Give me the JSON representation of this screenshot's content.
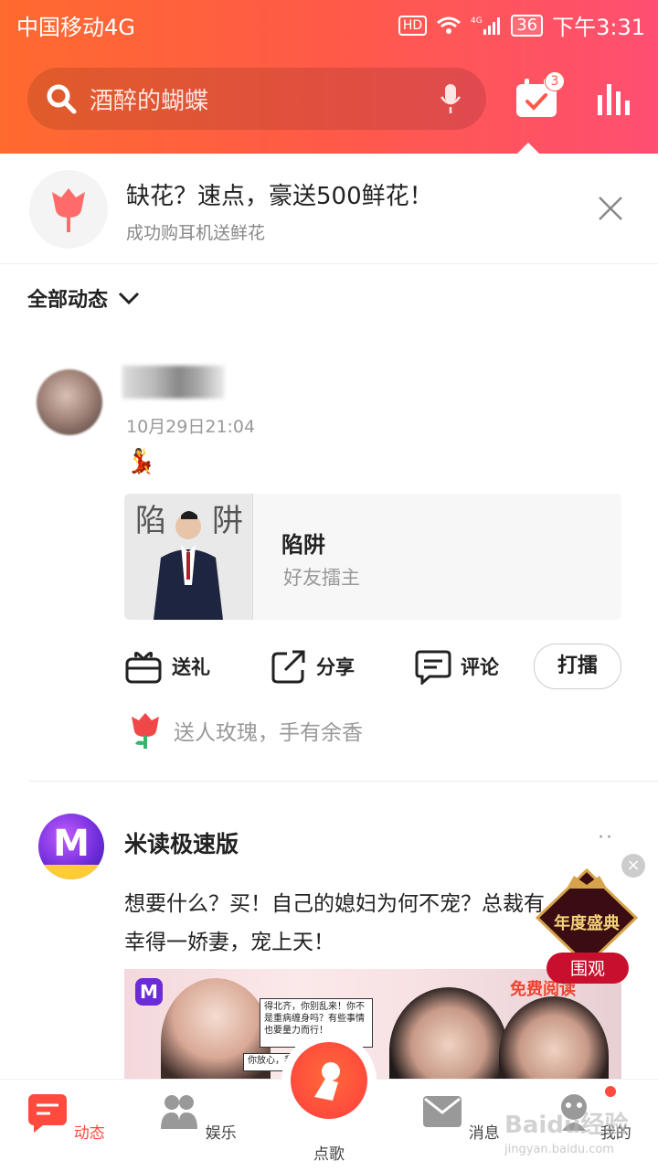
{
  "status_bar": {
    "carrier": "中国移动4G",
    "hd": "HD",
    "network": "4G",
    "battery": "36",
    "time": "下午3:31"
  },
  "header": {
    "search_placeholder": "酒醉的蝴蝶",
    "calendar_badge": "3"
  },
  "promo": {
    "title": "缺花？速点，豪送500鲜花！",
    "subtitle": "成功购耳机送鲜花"
  },
  "filter": {
    "label": "全部动态"
  },
  "post1": {
    "time": "10月29日21:04",
    "emoji": "💃",
    "song": {
      "cover_left": "陷",
      "cover_right": "阱",
      "title": "陷阱",
      "subtitle": "好友擂主"
    },
    "actions": {
      "gift": "送礼",
      "share": "分享",
      "comment": "评论",
      "challenge": "打擂"
    },
    "rose_text": "送人玫瑰，手有余香"
  },
  "post2": {
    "name": "米读极速版",
    "more": "··",
    "text": "想要什么？买！自己的媳妇为何不宠？总裁有幸得一娇妻，宠上天！",
    "image_free_text": "免费阅读",
    "bubble1": "得北齐，你别乱来！你不是重病缠身吗？有些事情也要量力而行！",
    "bubble2": "你放心，我…"
  },
  "float": {
    "title": "年度盛典",
    "button": "围观"
  },
  "tabbar": {
    "feed": "动态",
    "fun": "娱乐",
    "sing": "点歌",
    "msg": "消息",
    "me": "我的"
  },
  "watermark": {
    "main": "Baidu经验",
    "sub": "jingyan.baidu.com"
  },
  "colors": {
    "accent": "#ff4a3d",
    "header_start": "#ff6a2f",
    "header_end": "#ff4f72"
  }
}
